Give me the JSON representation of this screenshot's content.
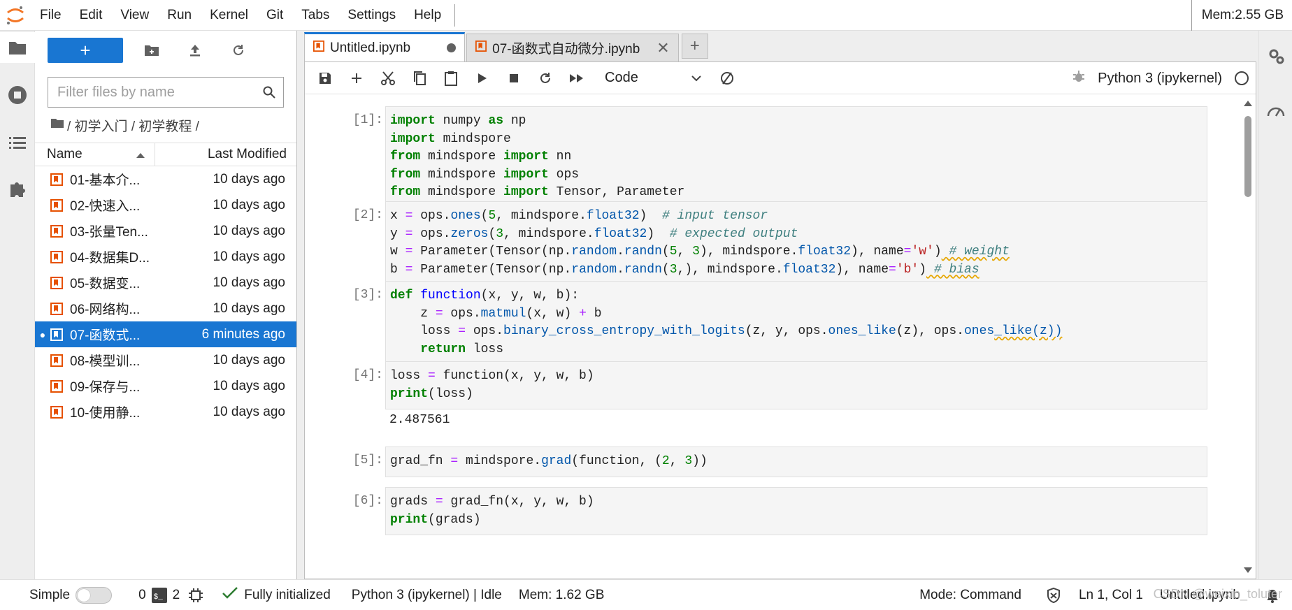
{
  "menubar": {
    "items": [
      "File",
      "Edit",
      "View",
      "Run",
      "Kernel",
      "Git",
      "Tabs",
      "Settings",
      "Help"
    ],
    "memory": "Mem:2.55 GB"
  },
  "filebrowser": {
    "new_label": "+",
    "filter_placeholder": "Filter files by name",
    "breadcrumb": "/ 初学入门 / 初学教程 /",
    "col_name": "Name",
    "col_modified": "Last Modified",
    "files": [
      {
        "name": "01-基本介...",
        "modified": "10 days ago"
      },
      {
        "name": "02-快速入...",
        "modified": "10 days ago"
      },
      {
        "name": "03-张量Ten...",
        "modified": "10 days ago"
      },
      {
        "name": "04-数据集D...",
        "modified": "10 days ago"
      },
      {
        "name": "05-数据变...",
        "modified": "10 days ago"
      },
      {
        "name": "06-网络构...",
        "modified": "10 days ago"
      },
      {
        "name": "07-函数式...",
        "modified": "6 minutes ago"
      },
      {
        "name": "08-模型训...",
        "modified": "10 days ago"
      },
      {
        "name": "09-保存与...",
        "modified": "10 days ago"
      },
      {
        "name": "10-使用静...",
        "modified": "10 days ago"
      }
    ]
  },
  "tabs": [
    {
      "label": "Untitled.ipynb"
    },
    {
      "label": "07-函数式自动微分.ipynb"
    }
  ],
  "notebook": {
    "cell_type": "Code",
    "kernel": "Python 3 (ipykernel)",
    "cells": [
      {
        "prompt": "[1]:"
      },
      {
        "prompt": "[2]:"
      },
      {
        "prompt": "[3]:"
      },
      {
        "prompt": "[4]:",
        "output": "2.487561"
      },
      {
        "prompt": "[5]:"
      },
      {
        "prompt": "[6]:"
      }
    ]
  },
  "statusbar": {
    "mode_simple": "Simple",
    "count_a": "0",
    "count_b": "2",
    "init": "Fully initialized",
    "kernel_status": "Python 3 (ipykernel) | Idle",
    "mem": "Mem: 1.62 GB",
    "mode": "Mode: Command",
    "cursor": "Ln 1, Col 1",
    "file": "Untitled.ipynb",
    "watermark": "CSDN @weixin_toluter"
  },
  "colors": {
    "accent": "#1976d2",
    "notebook_icon": "#e65100",
    "keyword": "#008000",
    "string": "#ba2121",
    "comment": "#408080"
  }
}
